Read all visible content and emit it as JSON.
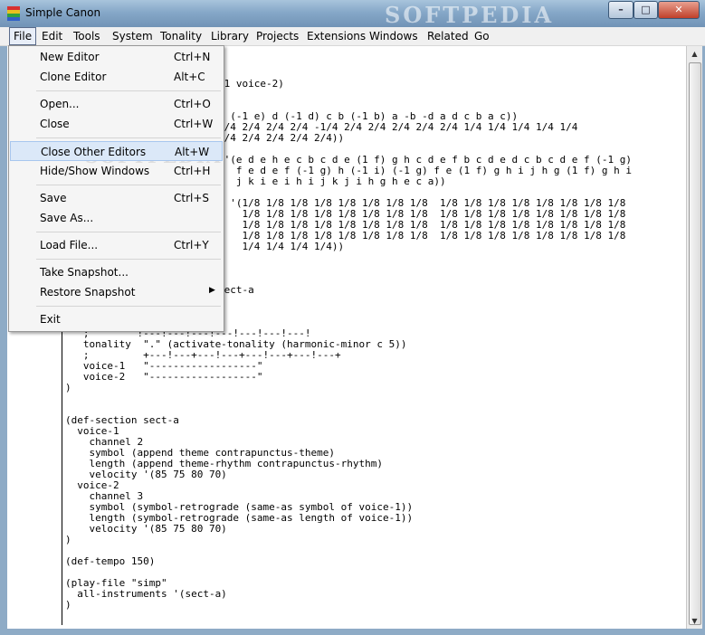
{
  "window": {
    "title": "Simple Canon",
    "watermark": "SOFTPEDIA",
    "controls": {
      "minimize": "–",
      "maximize": "□",
      "close": "✕"
    }
  },
  "menubar": {
    "items": [
      "File",
      "Edit",
      "Tools",
      "System",
      "Tonality",
      "Library",
      "Projects",
      "Extensions",
      "Windows",
      "Related",
      "Go"
    ]
  },
  "file_menu": {
    "watermark": "SOFTPEDIA",
    "groups": [
      [
        {
          "label": "New Editor",
          "shortcut": "Ctrl+N"
        },
        {
          "label": "Clone Editor",
          "shortcut": "Alt+C"
        }
      ],
      [
        {
          "label": "Open...",
          "shortcut": "Ctrl+O"
        },
        {
          "label": "Close",
          "shortcut": "Ctrl+W"
        }
      ],
      [
        {
          "label": "Close Other Editors",
          "shortcut": "Alt+W"
        },
        {
          "label": "Hide/Show Windows",
          "shortcut": "Ctrl+H"
        }
      ],
      [
        {
          "label": "Save",
          "shortcut": "Ctrl+S"
        },
        {
          "label": "Save As...",
          "shortcut": ""
        }
      ],
      [
        {
          "label": "Load File...",
          "shortcut": "Ctrl+Y"
        }
      ],
      [
        {
          "label": "Take Snapshot...",
          "shortcut": ""
        },
        {
          "label": "Restore Snapshot",
          "shortcut": "▶"
        }
      ],
      [
        {
          "label": "Exit",
          "shortcut": ""
        }
      ]
    ],
    "highlighted": "Close Other Editors"
  },
  "editor": {
    "fragments_top": "-1 voice-2)\n\n\ne (-1 e) d (-1 d) c b (-1 b) a -b -d a d c b a c))\n2/4 2/4 2/4 2/4 -1/4 2/4 2/4 2/4 2/4 2/4 1/4 1/4 1/4 1/4 1/4\n2/4 2/4 2/4 2/4 2/4))\n\n '(e d e h e c b c d e (1 f) g h c d e f b c d e d c b c d e f (-1 g)\n   f e d e f (-1 g) h (-1 i) (-1 g) f e (1 f) g h i j h g (1 f) g h i\n   j k i e i h i j k j i h g h e c a))\n\nm '(1/8 1/8 1/8 1/8 1/8 1/8 1/8 1/8  1/8 1/8 1/8 1/8 1/8 1/8 1/8 1/8\n    1/8 1/8 1/8 1/8 1/8 1/8 1/8 1/8  1/8 1/8 1/8 1/8 1/8 1/8 1/8 1/8\n    1/8 1/8 1/8 1/8 1/8 1/8 1/8 1/8  1/8 1/8 1/8 1/8 1/8 1/8 1/8 1/8\n    1/8 1/8 1/8 1/8 1/8 1/8 1/8 1/8  1/8 1/8 1/8 1/8 1/8 1/8 1/8 1/8\n    1/4 1/4 1/4 1/4))\n\n\n\nsect-a",
    "visible_code": "   ;        !---!---!---!---!---!---!---!\n   tonality  \".\" (activate-tonality (harmonic-minor c 5))\n   ;         +---!---+---!---+---!---+---!---+\n   voice-1   \"------------------\"\n   voice-2   \"------------------\"\n)\n\n\n(def-section sect-a\n  voice-1\n    channel 2\n    symbol (append theme contrapunctus-theme)\n    length (append theme-rhythm contrapunctus-rhythm)\n    velocity '(85 75 80 70)\n  voice-2\n    channel 3\n    symbol (symbol-retrograde (same-as symbol of voice-1))\n    length (symbol-retrograde (same-as length of voice-1))\n    velocity '(85 75 80 70)\n)\n\n(def-tempo 150)\n\n(play-file \"simp\"\n  all-instruments '(sect-a)\n)"
  },
  "colors": {
    "titlebar": "#86a8c8",
    "menu_highlight": "#dbe8f8",
    "close_button": "#c0402a"
  }
}
